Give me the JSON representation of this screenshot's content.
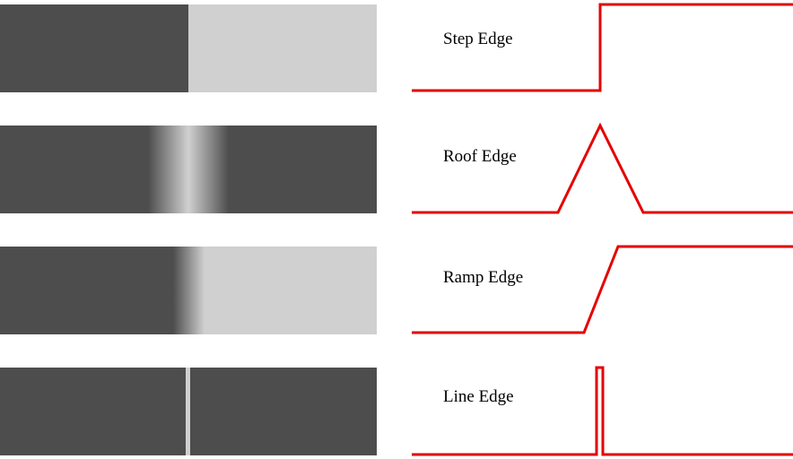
{
  "colors": {
    "dark": "#4d4d4d",
    "light": "#d0d0d0",
    "profile_line": "#e50000"
  },
  "edges": [
    {
      "label": "Step Edge",
      "type": "step"
    },
    {
      "label": "Roof Edge",
      "type": "roof"
    },
    {
      "label": "Ramp Edge",
      "type": "ramp"
    },
    {
      "label": "Line Edge",
      "type": "line"
    }
  ]
}
